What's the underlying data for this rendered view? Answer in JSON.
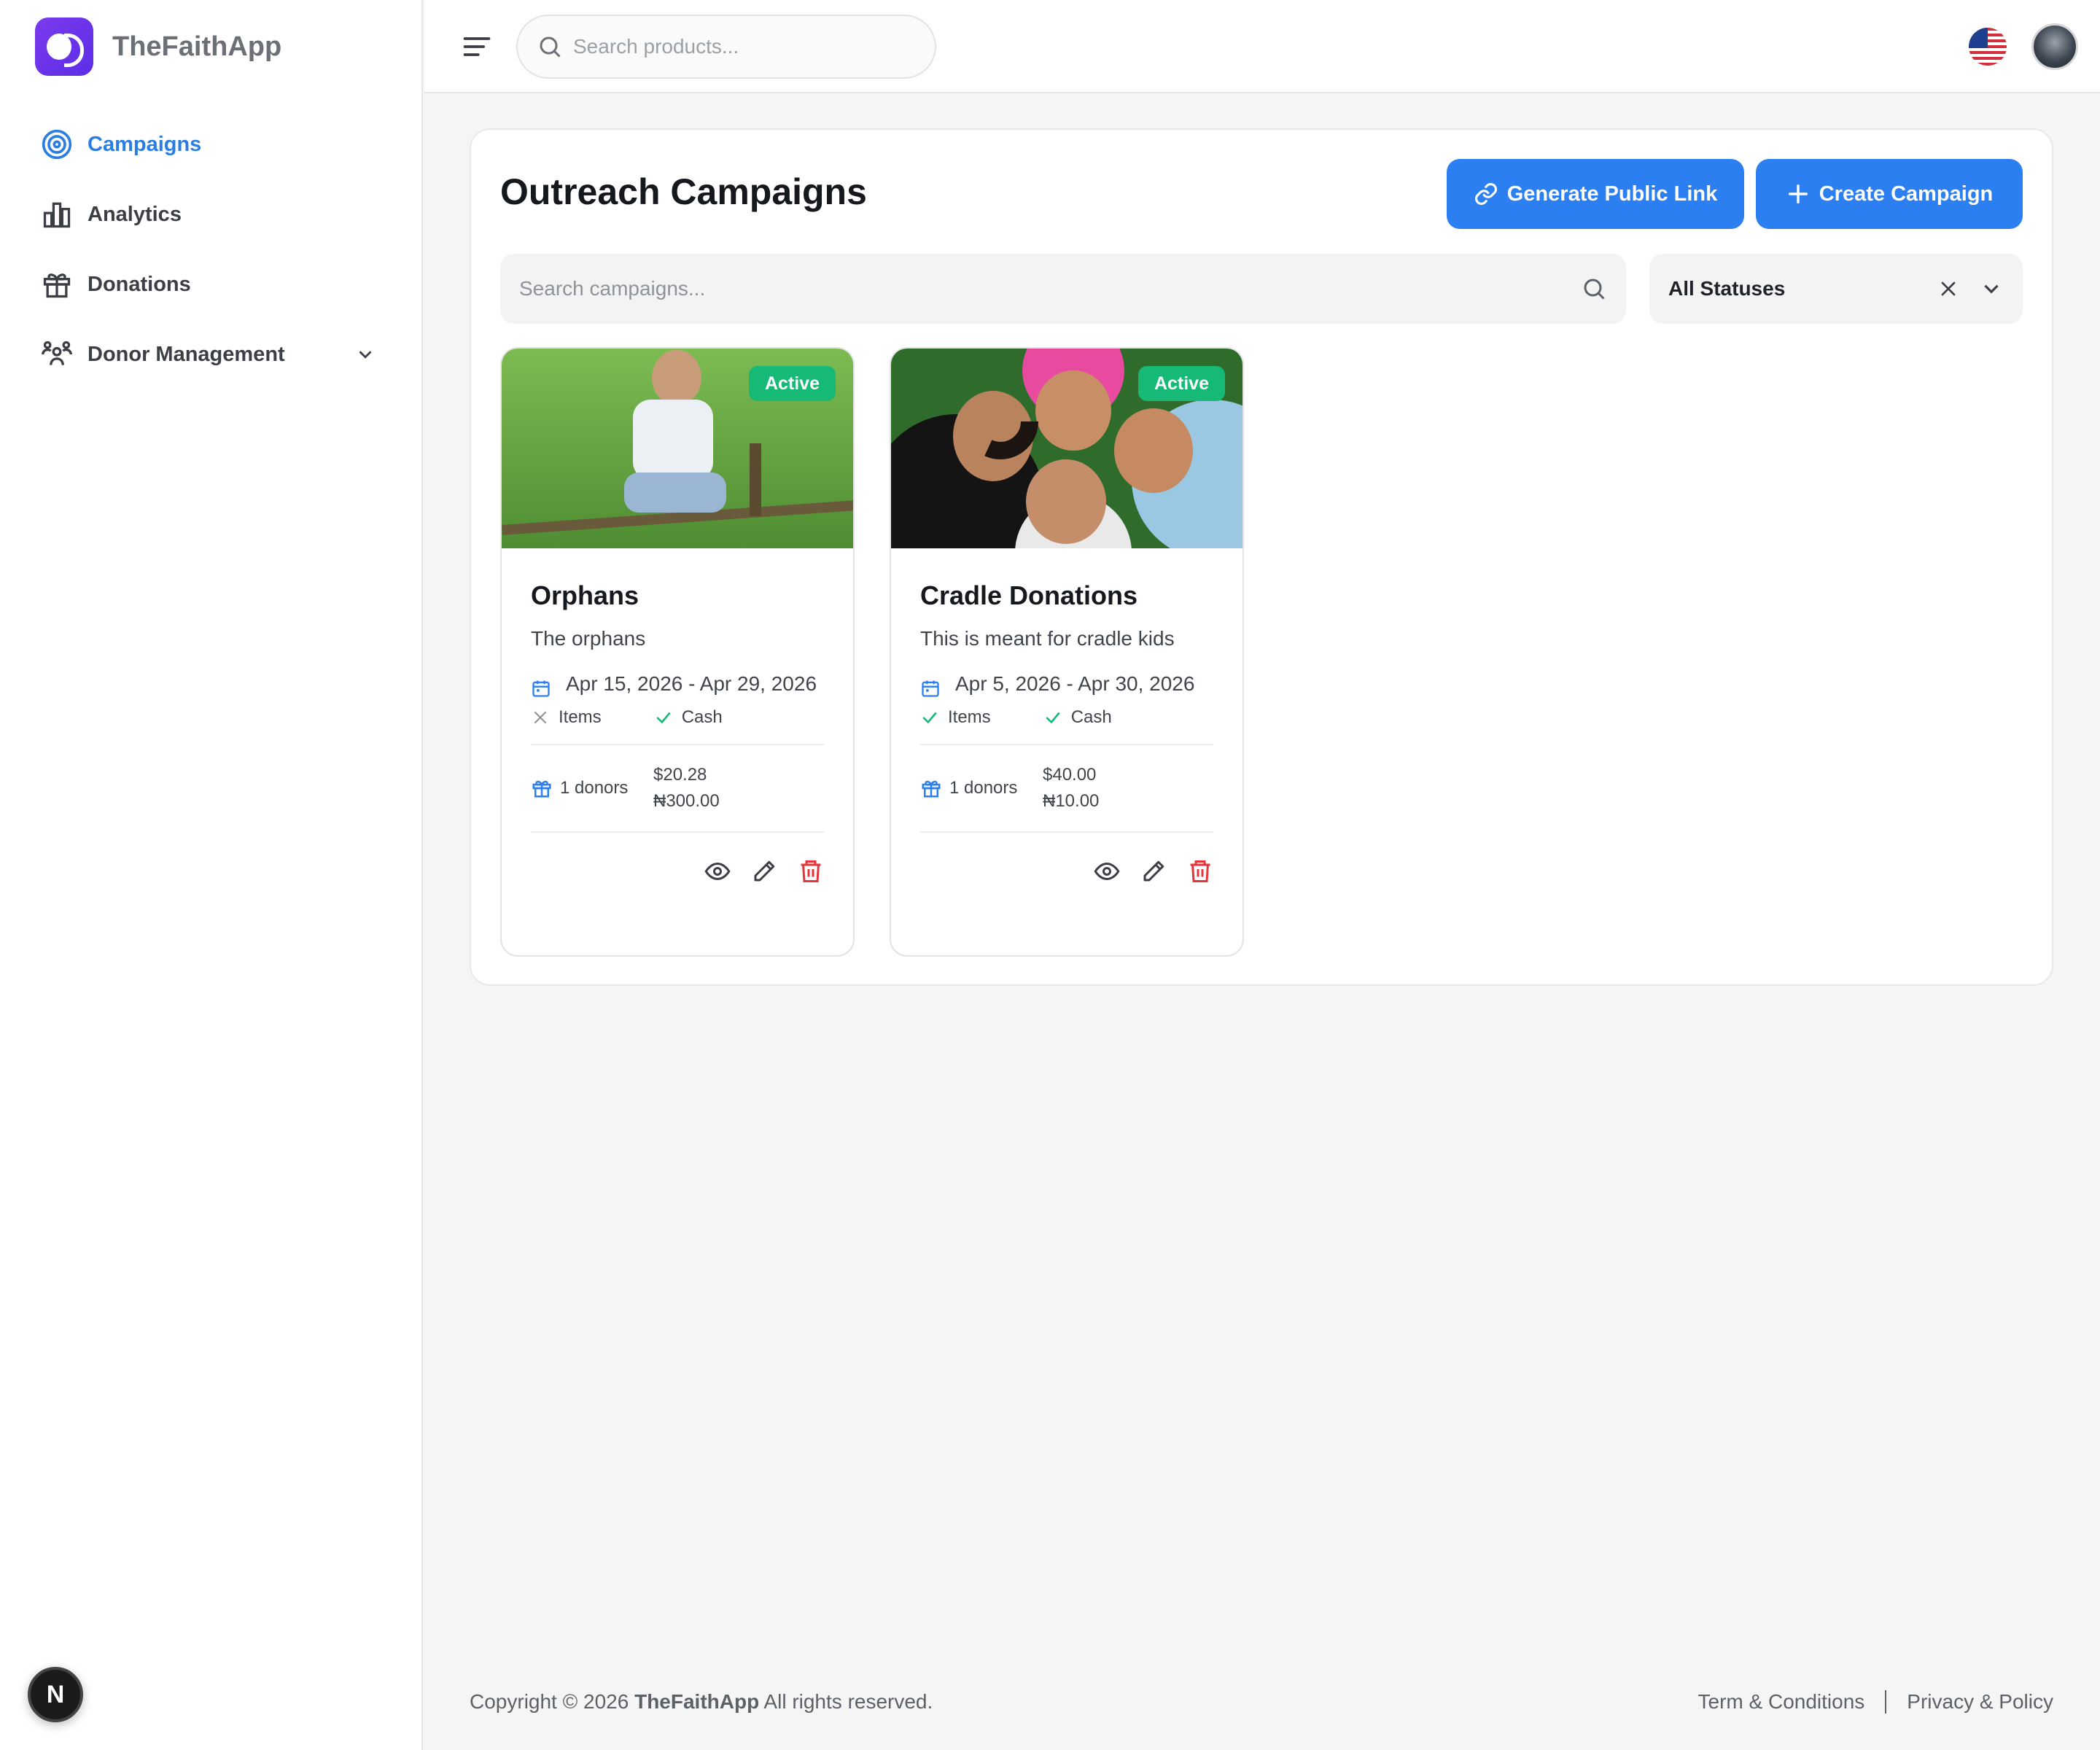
{
  "app": {
    "name": "TheFaithApp"
  },
  "sidebar": {
    "items": [
      {
        "label": "Campaigns",
        "icon": "target-icon",
        "active": true
      },
      {
        "label": "Analytics",
        "icon": "bar-chart-icon"
      },
      {
        "label": "Donations",
        "icon": "gift-icon"
      },
      {
        "label": "Donor Management",
        "icon": "users-icon",
        "expandable": true
      }
    ]
  },
  "topbar": {
    "search_placeholder": "Search products...",
    "language_flag": "us-flag-icon"
  },
  "page": {
    "title": "Outreach Campaigns",
    "generate_link_label": "Generate Public Link",
    "create_label": "Create Campaign",
    "search_placeholder": "Search campaigns...",
    "status_filter": "All Statuses"
  },
  "campaigns": [
    {
      "status": "Active",
      "title": "Orphans",
      "description": "The orphans",
      "date_range": "Apr 15, 2026 - Apr 29, 2026",
      "types": [
        {
          "label": "Items",
          "enabled": false
        },
        {
          "label": "Cash",
          "enabled": true
        }
      ],
      "donors": "1 donors",
      "amount_usd": "$20.28",
      "amount_ngn": "₦300.00"
    },
    {
      "status": "Active",
      "title": "Cradle Donations",
      "description": "This is meant for cradle kids",
      "date_range": "Apr 5, 2026 - Apr 30, 2026",
      "types": [
        {
          "label": "Items",
          "enabled": true
        },
        {
          "label": "Cash",
          "enabled": true
        }
      ],
      "donors": "1 donors",
      "amount_usd": "$40.00",
      "amount_ngn": "₦10.00"
    }
  ],
  "footer": {
    "copyright_prefix": "Copyright © 2026",
    "brand": "TheFaithApp",
    "copyright_suffix": "All rights reserved.",
    "terms": "Term & Conditions",
    "privacy": "Privacy & Policy"
  },
  "colors": {
    "primary": "#2b7ff0",
    "active_badge": "#16b975",
    "brand": "#6d35ea",
    "danger": "#e5343c"
  }
}
